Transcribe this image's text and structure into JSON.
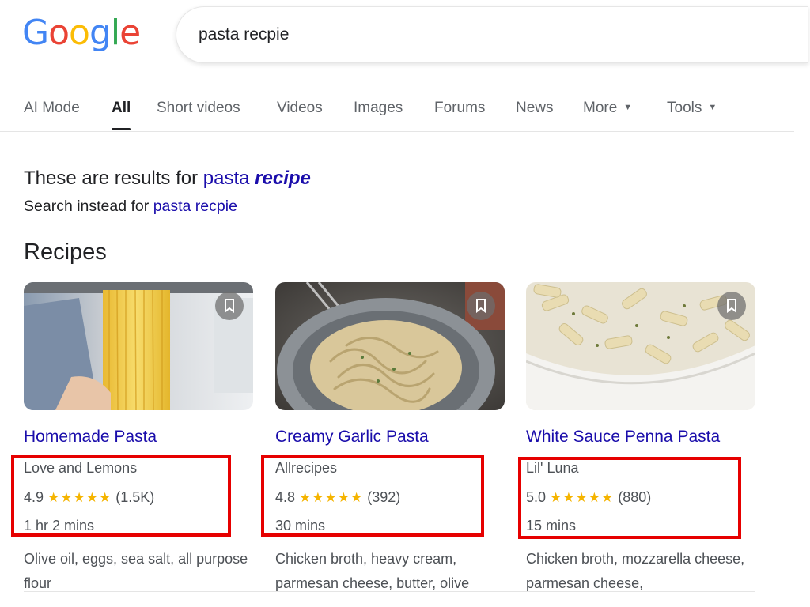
{
  "logo": {
    "letters": [
      "G",
      "o",
      "o",
      "g",
      "l",
      "e"
    ],
    "colors": [
      "#4285F4",
      "#EA4335",
      "#FBBC05",
      "#4285F4",
      "#34A853",
      "#EA4335"
    ]
  },
  "search": {
    "query": "pasta recpie"
  },
  "tabs": [
    {
      "label": "AI Mode",
      "active": false
    },
    {
      "label": "All",
      "active": true
    },
    {
      "label": "Short videos",
      "active": false
    },
    {
      "label": "Videos",
      "active": false
    },
    {
      "label": "Images",
      "active": false
    },
    {
      "label": "Forums",
      "active": false
    },
    {
      "label": "News",
      "active": false
    },
    {
      "label": "More",
      "active": false,
      "dropdown": true
    },
    {
      "label": "Tools",
      "active": false,
      "dropdown": true
    }
  ],
  "spelling": {
    "prefix": "These are results for",
    "corrected_word1": "pasta",
    "corrected_word2": "recipe",
    "instead_prefix": "Search instead for",
    "original_query": "pasta recpie"
  },
  "recipes_title": "Recipes",
  "recipes": [
    {
      "title": "Homemade Pasta",
      "source": "Love and Lemons",
      "rating": "4.9",
      "stars": "★★★★★",
      "reviews": "(1.5K)",
      "time": "1 hr 2 mins",
      "ingredients": "Olive oil, eggs, sea salt, all purpose flour"
    },
    {
      "title": "Creamy Garlic Pasta",
      "source": "Allrecipes",
      "rating": "4.8",
      "stars": "★★★★★",
      "reviews": "(392)",
      "time": "30 mins",
      "ingredients": "Chicken broth, heavy cream, parmesan cheese, butter, olive"
    },
    {
      "title": "White Sauce Penna Pasta",
      "source": "Lil' Luna",
      "rating": "5.0",
      "stars": "★★★★★",
      "reviews": "(880)",
      "time": "15 mins",
      "ingredients": "Chicken broth, mozzarella cheese, parmesan cheese,"
    }
  ],
  "colors": {
    "link": "#1a0dab",
    "star": "#f5b400",
    "highlight": "#e60000"
  }
}
